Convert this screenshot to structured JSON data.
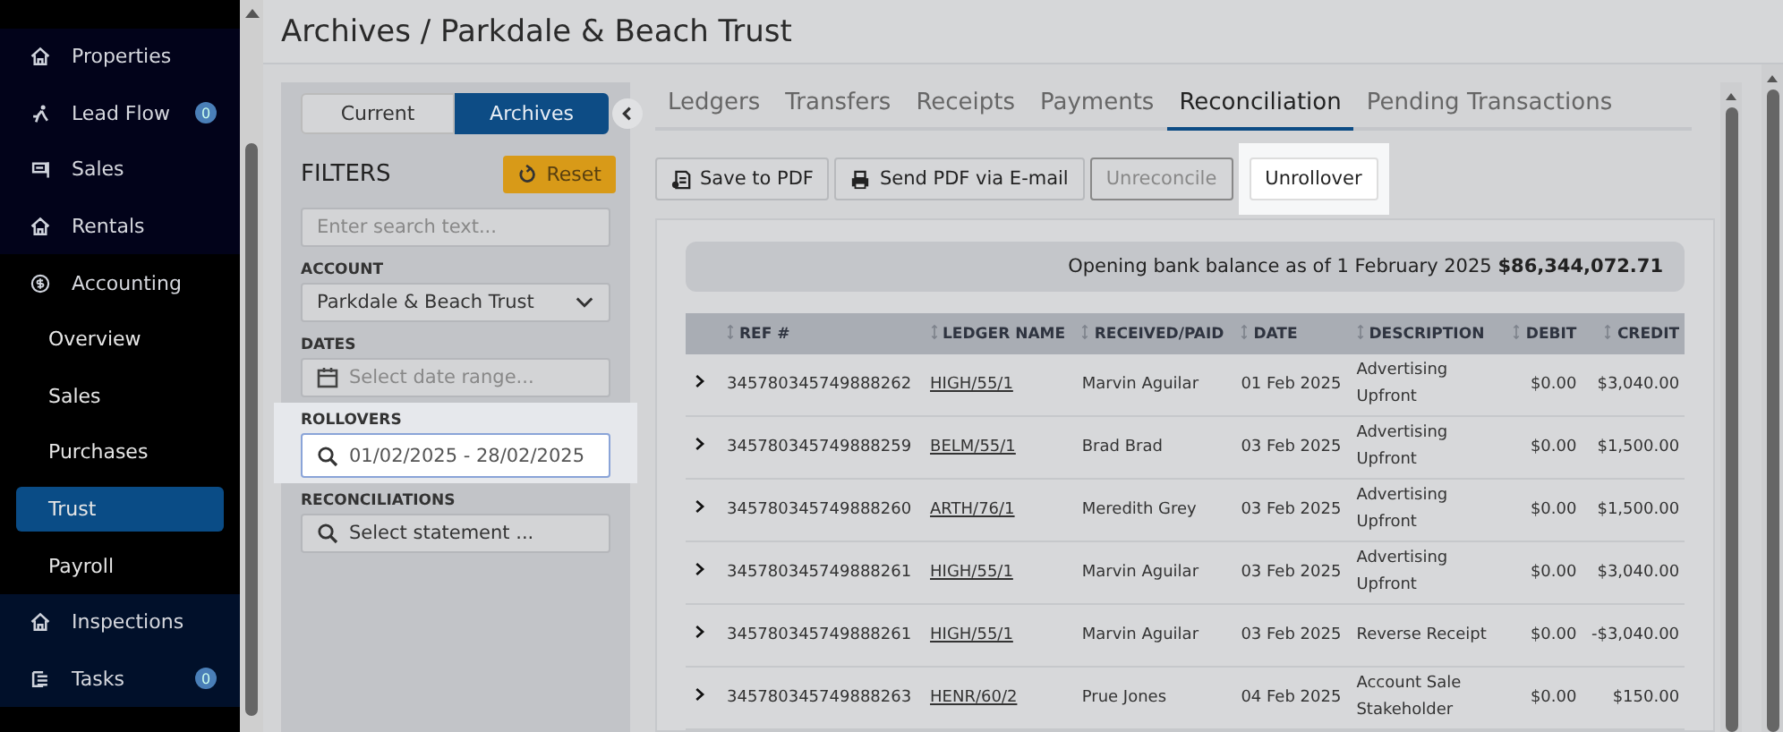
{
  "sidebar": {
    "items": [
      {
        "kind": "section",
        "label": "Properties"
      },
      {
        "kind": "section",
        "label": "Lead Flow",
        "badge": "0"
      },
      {
        "kind": "section",
        "label": "Sales"
      },
      {
        "kind": "section",
        "label": "Rentals"
      },
      {
        "kind": "section",
        "label": "Accounting"
      },
      {
        "kind": "sub",
        "label": "Overview",
        "selected": false
      },
      {
        "kind": "sub",
        "label": "Sales",
        "selected": false
      },
      {
        "kind": "sub",
        "label": "Purchases",
        "selected": false
      },
      {
        "kind": "sub",
        "label": "Trust",
        "selected": true
      },
      {
        "kind": "sub",
        "label": "Payroll",
        "selected": false
      },
      {
        "kind": "section",
        "label": "Inspections"
      },
      {
        "kind": "section",
        "label": "Tasks",
        "badge": "0"
      }
    ]
  },
  "page_title": "Archives / Parkdale & Beach Trust",
  "filter_panel": {
    "toggle": [
      {
        "label": "Current",
        "selected": false
      },
      {
        "label": "Archives",
        "selected": true
      }
    ],
    "title": "FILTERS",
    "reset": "Reset",
    "search": {
      "placeholder": "Enter search text..."
    },
    "fields": [
      {
        "label": "ACCOUNT",
        "kind": "select",
        "value": "Parkdale & Beach Trust",
        "highlighted": false
      },
      {
        "label": "DATES",
        "kind": "date",
        "placeholder": "Select date range...",
        "highlighted": false
      },
      {
        "label": "ROLLOVERS",
        "kind": "search",
        "value": "01/02/2025 - 28/02/2025",
        "highlighted": true
      },
      {
        "label": "RECONCILIATIONS",
        "kind": "search",
        "placeholder": "Select statement ...",
        "highlighted": false
      }
    ]
  },
  "tabs": [
    {
      "label": "Ledgers",
      "selected": false
    },
    {
      "label": "Transfers",
      "selected": false
    },
    {
      "label": "Receipts",
      "selected": false
    },
    {
      "label": "Payments",
      "selected": false
    },
    {
      "label": "Reconciliation",
      "selected": true
    },
    {
      "label": "Pending Transactions",
      "selected": false
    }
  ],
  "toolbar": [
    {
      "label": "Save to PDF",
      "disabled": false,
      "highlighted": false
    },
    {
      "label": "Send PDF via E-mail",
      "disabled": false,
      "highlighted": false
    },
    {
      "label": "Unreconcile",
      "disabled": true,
      "highlighted": false
    },
    {
      "label": "Unrollover",
      "disabled": false,
      "highlighted": true
    }
  ],
  "balance": {
    "text": "Opening bank balance as of 1 February 2025",
    "amount": "$86,344,072.71"
  },
  "table": {
    "columns": [
      "REF #",
      "LEDGER NAME",
      "RECEIVED/PAID",
      "DATE",
      "DESCRIPTION",
      "DEBIT",
      "CREDIT"
    ],
    "rows": [
      [
        "345780345749888262",
        "HIGH/55/1",
        "Marvin Aguilar",
        "01 Feb 2025",
        "Advertising Upfront",
        "$0.00",
        "$3,040.00"
      ],
      [
        "345780345749888259",
        "BELM/55/1",
        "Brad Brad",
        "03 Feb 2025",
        "Advertising Upfront",
        "$0.00",
        "$1,500.00"
      ],
      [
        "345780345749888260",
        "ARTH/76/1",
        "Meredith Grey",
        "03 Feb 2025",
        "Advertising Upfront",
        "$0.00",
        "$1,500.00"
      ],
      [
        "345780345749888261",
        "HIGH/55/1",
        "Marvin Aguilar",
        "03 Feb 2025",
        "Advertising Upfront",
        "$0.00",
        "$3,040.00"
      ],
      [
        "345780345749888261",
        "HIGH/55/1",
        "Marvin Aguilar",
        "03 Feb 2025",
        "Reverse Receipt",
        "$0.00",
        "-$3,040.00"
      ],
      [
        "345780345749888263",
        "HENR/60/2",
        "Prue Jones",
        "04 Feb 2025",
        "Account Sale Stakeholder",
        "$0.00",
        "$150.00"
      ]
    ]
  }
}
